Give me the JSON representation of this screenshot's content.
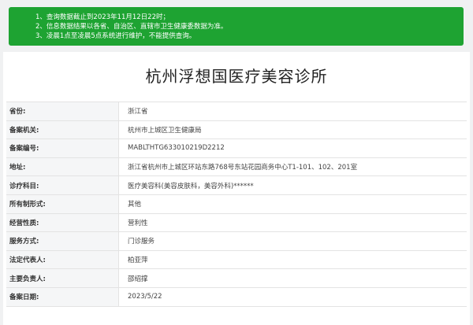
{
  "notice": {
    "lines": [
      "1、查询数据截止到2023年11月12日22时；",
      "2、信息数据结果以各省、自治区、直辖市卫生健康委数据为准。",
      "3、凌晨1点至凌晨5点系统进行维护，不能提供查询。"
    ]
  },
  "clinic": {
    "title": "杭州浮想国医疗美容诊所"
  },
  "fields": [
    {
      "label": "省份:",
      "value": "浙江省"
    },
    {
      "label": "备案机关:",
      "value": "杭州市上城区卫生健康局"
    },
    {
      "label": "备案编号:",
      "value": "MABLTHTG633010219D2212"
    },
    {
      "label": "地址:",
      "value": "浙江省杭州市上城区环站东路768号东站花园商务中心T1-101、102、201室"
    },
    {
      "label": "诊疗科目:",
      "value": "医疗美容科(美容皮肤科，美容外科)******"
    },
    {
      "label": "所有制形式:",
      "value": "其他"
    },
    {
      "label": "经营性质:",
      "value": "营利性"
    },
    {
      "label": "服务方式:",
      "value": "门诊服务"
    },
    {
      "label": "法定代表人:",
      "value": "柏亚萍"
    },
    {
      "label": "主要负责人:",
      "value": "邵绍撑"
    },
    {
      "label": "备案日期:",
      "value": "2023/5/22"
    }
  ]
}
